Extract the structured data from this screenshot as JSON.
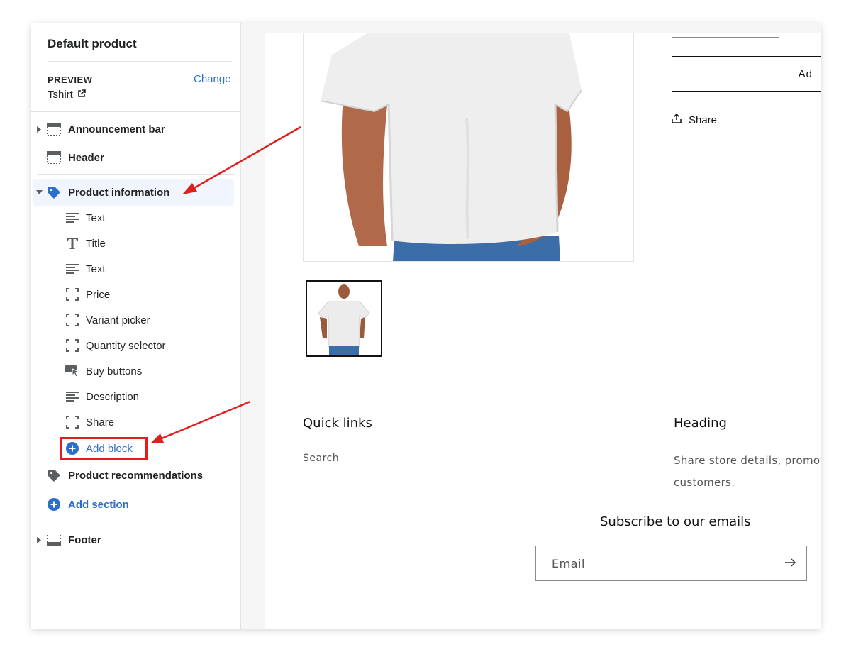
{
  "sidebar": {
    "title": "Default product",
    "preview_label": "PREVIEW",
    "change_label": "Change",
    "preview_value": "Tshirt",
    "sections": {
      "announcement": "Announcement bar",
      "header": "Header",
      "product_info": "Product information",
      "product_recs": "Product recommendations",
      "add_section": "Add section",
      "footer": "Footer"
    },
    "blocks": [
      {
        "label": "Text",
        "icon": "text-lines-icon"
      },
      {
        "label": "Title",
        "icon": "title-t-icon"
      },
      {
        "label": "Text",
        "icon": "text-lines-icon"
      },
      {
        "label": "Price",
        "icon": "dashed-block-icon"
      },
      {
        "label": "Variant picker",
        "icon": "dashed-block-icon"
      },
      {
        "label": "Quantity selector",
        "icon": "dashed-block-icon"
      },
      {
        "label": "Buy buttons",
        "icon": "buy-cursor-icon"
      },
      {
        "label": "Description",
        "icon": "text-lines-icon"
      },
      {
        "label": "Share",
        "icon": "dashed-block-icon"
      }
    ],
    "add_block": "Add block"
  },
  "preview": {
    "add_to_cart_partial": "Ad",
    "share_label": "Share",
    "footer": {
      "quick_links_heading": "Quick links",
      "search_link": "Search",
      "heading": "Heading",
      "heading_text": "Share store details, promot customers.",
      "subscribe_heading": "Subscribe to our emails",
      "email_placeholder": "Email"
    }
  },
  "colors": {
    "accent_blue": "#2c6ecb",
    "annotation_red": "#e11d1d",
    "selected_bg": "#f1f5fe"
  }
}
